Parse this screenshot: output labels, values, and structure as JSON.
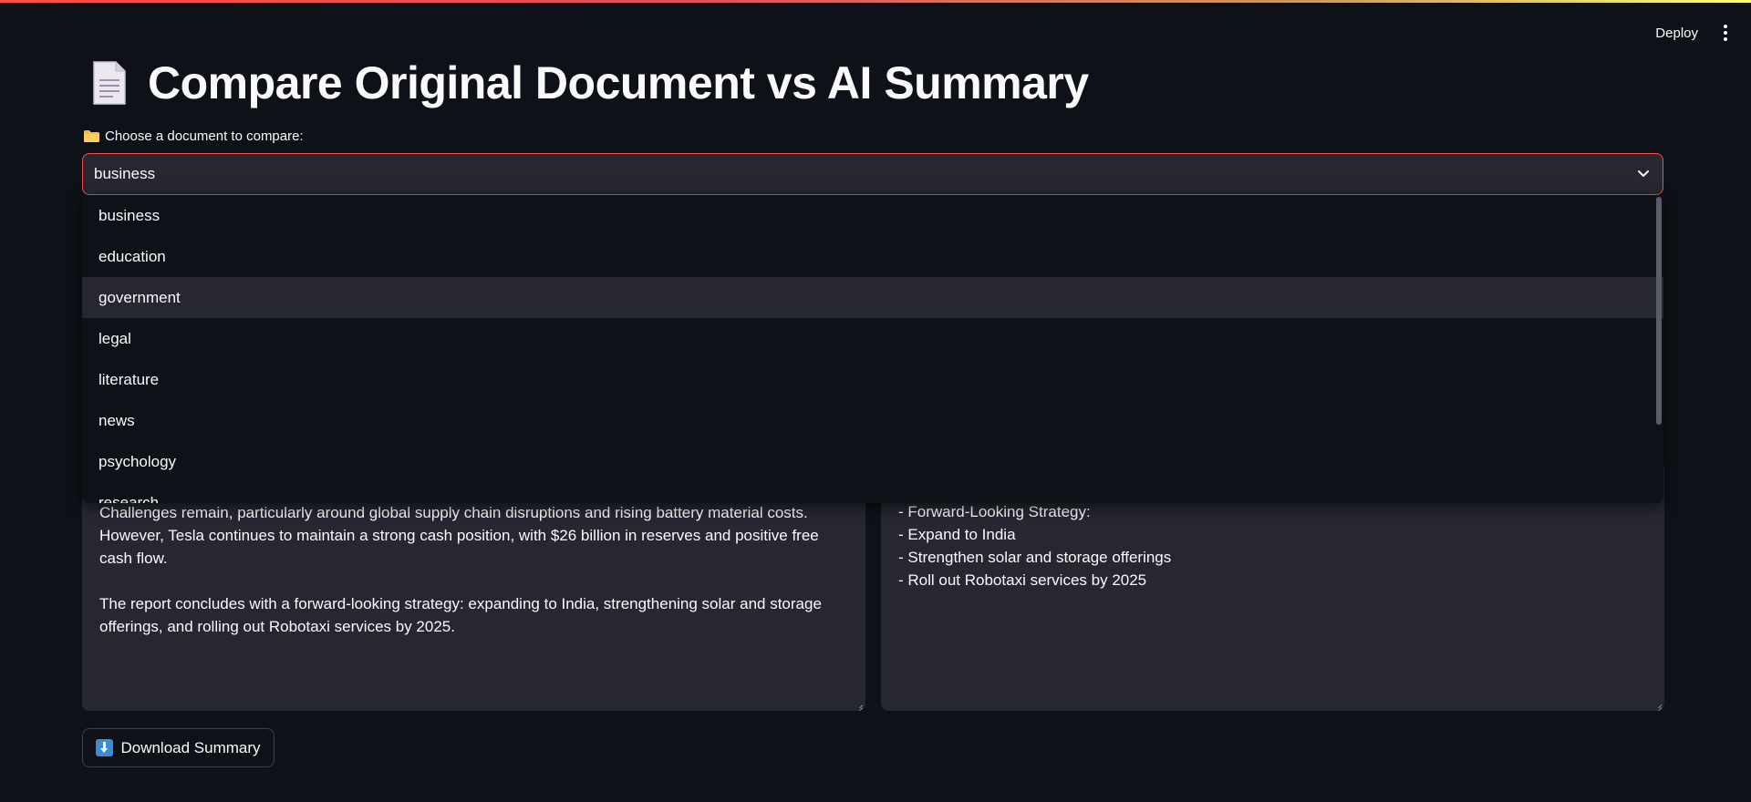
{
  "header": {
    "deploy_label": "Deploy",
    "menu_icon": "kebab-menu-icon"
  },
  "page": {
    "title": "Compare Original Document vs AI Summary",
    "title_icon": "page-facing-up-icon"
  },
  "selector": {
    "label": "Choose a document to compare:",
    "label_icon": "folder-icon",
    "value": "business",
    "options": [
      "business",
      "education",
      "government",
      "legal",
      "literature",
      "news",
      "psychology",
      "research"
    ],
    "highlighted_option": "government"
  },
  "original_panel": {
    "paragraphs": [
      "Challenges remain, particularly around global supply chain disruptions and rising battery material costs. However, Tesla continues to maintain a strong cash position, with $26 billion in reserves and positive free cash flow.",
      "The report concludes with a forward-looking strategy: expanding to India, strengthening solar and storage offerings, and rolling out Robotaxi services by 2025."
    ]
  },
  "summary_panel": {
    "lines": [
      "- Forward-Looking Strategy:",
      "- Expand to India",
      "- Strengthen solar and storage offerings",
      "- Roll out Robotaxi services by 2025"
    ]
  },
  "download": {
    "label": "Download Summary",
    "icon": "down-arrow-icon"
  },
  "colors": {
    "background": "#0e1117",
    "surface": "#262730",
    "accent": "#ff4b4b"
  }
}
